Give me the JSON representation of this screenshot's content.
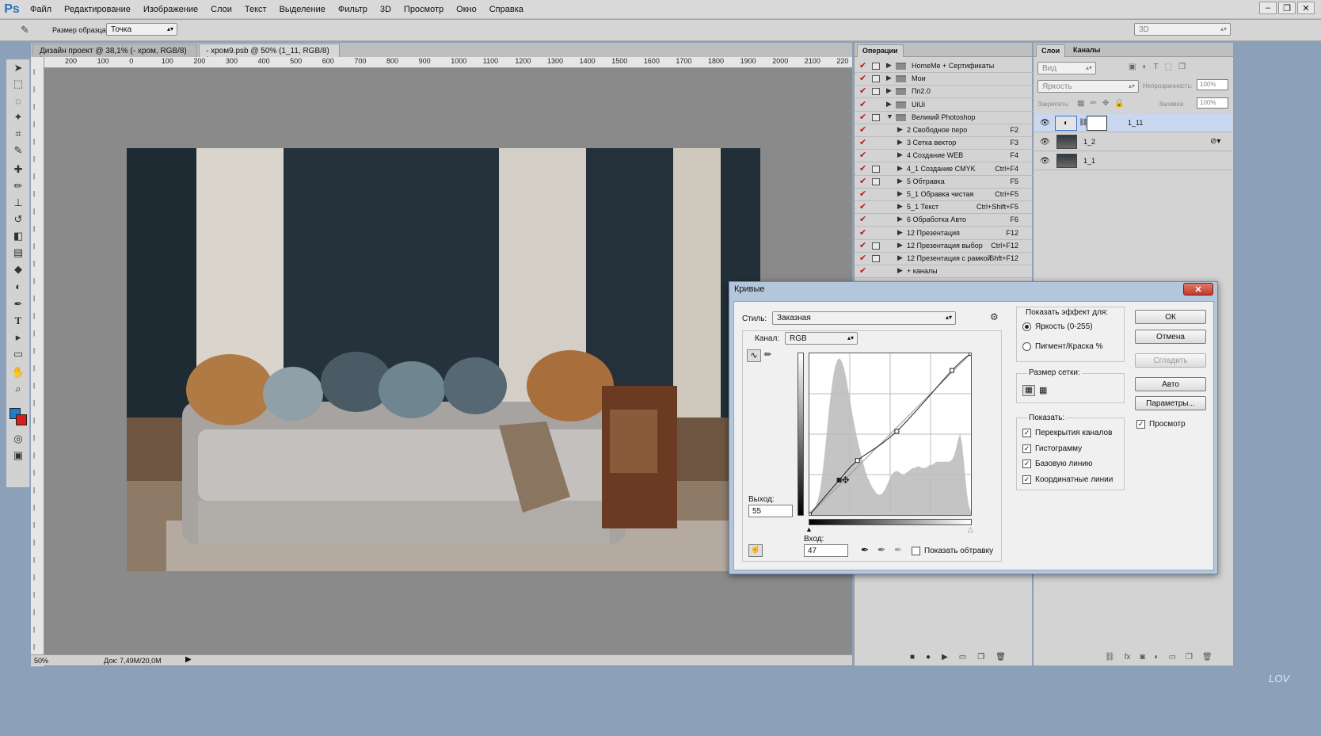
{
  "app": {
    "logo": "Ps"
  },
  "menu": [
    "Файл",
    "Редактирование",
    "Изображение",
    "Слои",
    "Текст",
    "Выделение",
    "Фильтр",
    "3D",
    "Просмотр",
    "Окно",
    "Справка"
  ],
  "window_controls": {
    "minimize": "–",
    "restore": "❐",
    "close": "✕"
  },
  "options_bar": {
    "sample_size_label": "Размер образца:",
    "sample_size_value": "Точка",
    "workspace": "3D"
  },
  "doc_tabs": [
    {
      "label": "Дизайн проект @ 38,1% (- хром, RGB/8) *"
    },
    {
      "label": "- хром9.psb @ 50% (1_11, RGB/8) *"
    }
  ],
  "ruler_h": [
    "200",
    "100",
    "0",
    "100",
    "200",
    "300",
    "400",
    "500",
    "600",
    "700",
    "800",
    "900",
    "1000",
    "1100",
    "1200",
    "1300",
    "1400",
    "1500",
    "1600",
    "1700",
    "1800",
    "1900",
    "2000",
    "2100",
    "220"
  ],
  "status": {
    "zoom": "50%",
    "doc": "Док: 7,49M/20,0M"
  },
  "actions_panel": {
    "tab": "Операции",
    "rows": [
      {
        "label": "HomeMe + Сертификаты",
        "key": "",
        "type": "folder",
        "dialog": true
      },
      {
        "label": "Мои",
        "key": "",
        "type": "folder",
        "dialog": true
      },
      {
        "label": "Пп2.0",
        "key": "",
        "type": "folder",
        "dialog": true
      },
      {
        "label": "UiUi",
        "key": "",
        "type": "folder",
        "dialog": false
      },
      {
        "label": "Великий Photoshop",
        "key": "",
        "type": "folder-open",
        "dialog": true
      },
      {
        "label": "2 Свободное перо",
        "key": "F2",
        "type": "action",
        "dialog": false
      },
      {
        "label": "3 Сетка вектор",
        "key": "F3",
        "type": "action",
        "dialog": false
      },
      {
        "label": "4 Создание WEB",
        "key": "F4",
        "type": "action",
        "dialog": false
      },
      {
        "label": "4_1 Создание CMYK",
        "key": "Ctrl+F4",
        "type": "action",
        "dialog": true
      },
      {
        "label": "5 Обтравка",
        "key": "F5",
        "type": "action",
        "dialog": true
      },
      {
        "label": "5_1 Обравка чистая",
        "key": "Ctrl+F5",
        "type": "action",
        "dialog": false
      },
      {
        "label": "5_1 Текст",
        "key": "Ctrl+Shift+F5",
        "type": "action",
        "dialog": false
      },
      {
        "label": "6 Обработка Авто",
        "key": "F6",
        "type": "action",
        "dialog": false
      },
      {
        "label": "12 Презентация",
        "key": "F12",
        "type": "action",
        "dialog": false
      },
      {
        "label": "12 Презентация выбор",
        "key": "Ctrl+F12",
        "type": "action",
        "dialog": true
      },
      {
        "label": "12 Презентация с рамкой",
        "key": "Shft+F12",
        "type": "action",
        "dialog": true
      },
      {
        "label": "+ каналы",
        "key": "",
        "type": "action",
        "dialog": false
      }
    ]
  },
  "layers_panel": {
    "tabs": [
      "Слои",
      "Каналы"
    ],
    "filter_placeholder": "Вид",
    "blend_mode": "Яркость",
    "opacity_label": "Непрозрачность:",
    "opacity_value": "100%",
    "lock_label": "Закрепить:",
    "fill_label": "Заливка:",
    "fill_value": "100%",
    "layers": [
      {
        "name": "1_11",
        "selected": true
      },
      {
        "name": "1_2",
        "selected": false
      },
      {
        "name": "1_1",
        "selected": false
      }
    ]
  },
  "curves": {
    "title": "Кривые",
    "close": "✕",
    "style_label": "Стиль:",
    "style_value": "Заказная",
    "channel_label": "Канал:",
    "channel_value": "RGB",
    "output_label": "Выход:",
    "output_value": "55",
    "input_label": "Вход:",
    "input_value": "47",
    "show_clipping": "Показать обтравку",
    "show_effect_for": "Показать эффект для:",
    "radio_brightness": "Яркость (0-255)",
    "radio_pigment": "Пигмент/Краска %",
    "grid_size": "Размер сетки:",
    "show_label": "Показать:",
    "show_options": [
      "Перекрытия каналов",
      "Гистограмму",
      "Базовую линию",
      "Координатные линии"
    ],
    "buttons": {
      "ok": "ОК",
      "cancel": "Отмена",
      "smooth": "Сгладить",
      "auto": "Авто",
      "options": "Параметры..."
    },
    "preview": "Просмотр",
    "points": [
      [
        0,
        0
      ],
      [
        47,
        55
      ],
      [
        76,
        86
      ],
      [
        138,
        132
      ],
      [
        225,
        228
      ],
      [
        255,
        255
      ]
    ],
    "histogram": [
      2,
      3,
      4,
      6,
      10,
      16,
      26,
      38,
      52,
      66,
      78,
      88,
      95,
      99,
      100,
      98,
      94,
      88,
      80,
      72,
      64,
      57,
      50,
      44,
      38,
      33,
      28,
      24,
      21,
      18,
      16,
      14,
      13,
      13,
      14,
      16,
      19,
      22,
      25,
      27,
      28,
      28,
      27,
      26,
      26,
      27,
      28,
      29,
      30,
      30,
      31,
      31,
      30,
      30,
      30,
      31,
      32,
      32,
      33,
      34,
      34,
      34,
      34,
      34,
      34,
      34,
      35,
      37,
      42,
      48,
      52,
      44,
      30,
      15,
      6,
      2
    ]
  },
  "watermark": "LOV"
}
